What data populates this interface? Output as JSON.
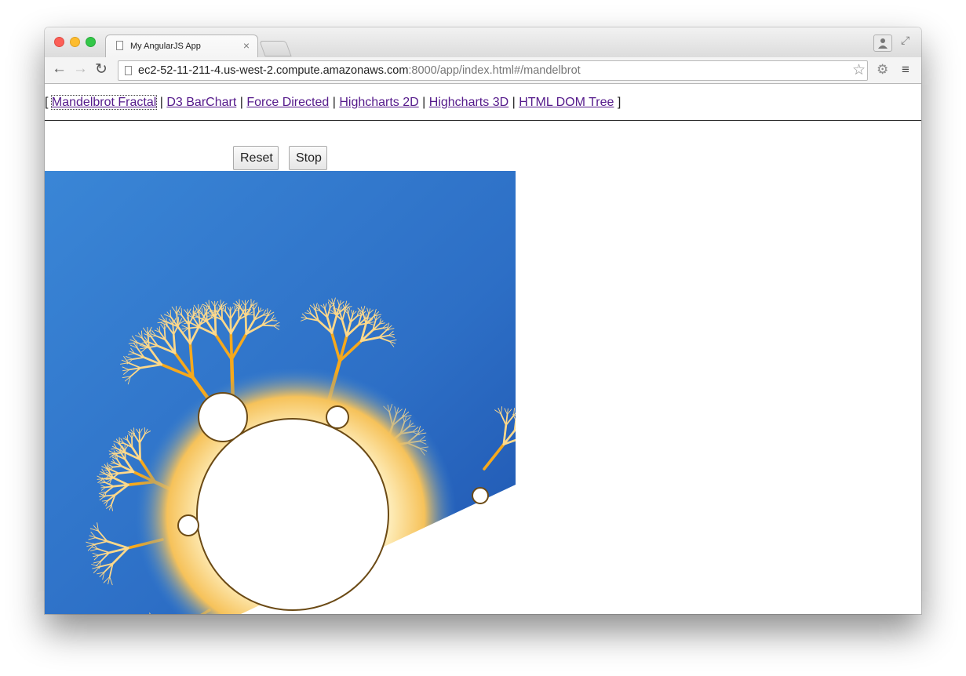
{
  "browser": {
    "tab_title": "My AngularJS App",
    "tab_close": "×",
    "url_host": "ec2-52-11-211-4.us-west-2.compute.amazonaws.com",
    "url_rest": ":8000/app/index.html#/mandelbrot"
  },
  "nav": {
    "open": "[",
    "sep": "|",
    "close": "]",
    "links": [
      "Mandelbrot Fractal",
      "D3 BarChart",
      "Force Directed",
      "Highcharts 2D",
      "Highcharts 3D",
      "HTML DOM Tree"
    ]
  },
  "controls": {
    "reset_label": "Reset",
    "stop_label": "Stop"
  },
  "colors": {
    "link": "#551a8b",
    "fractal_sky": "#2f7ad0",
    "fractal_gold": "#f6a91c"
  }
}
